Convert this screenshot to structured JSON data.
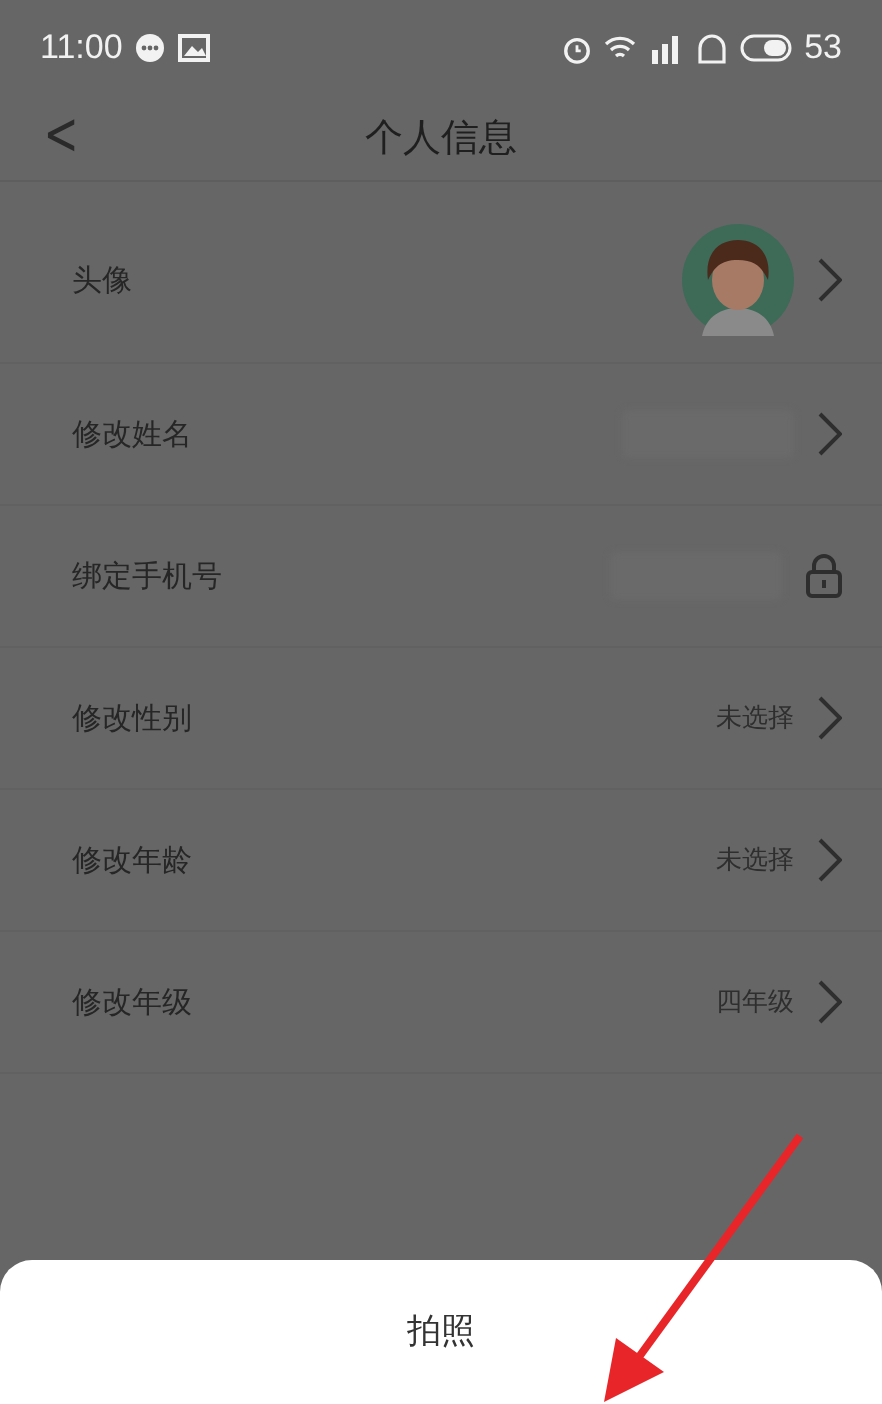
{
  "status_bar": {
    "time": "11:00",
    "battery": "53"
  },
  "header": {
    "back": "<",
    "title": "个人信息"
  },
  "rows": [
    {
      "label": "头像",
      "locked": false
    },
    {
      "label": "修改姓名",
      "kind": "redacted",
      "locked": false
    },
    {
      "label": "绑定手机号",
      "kind": "redacted",
      "locked": true
    },
    {
      "label": "修改性别",
      "kind": "text",
      "value": "未选择",
      "locked": false
    },
    {
      "label": "修改年龄",
      "kind": "text",
      "value": "未选择",
      "locked": false
    },
    {
      "label": "修改年级",
      "kind": "text",
      "value": "四年级",
      "locked": false
    }
  ],
  "sheet": {
    "options": [
      "拍照"
    ]
  },
  "annotation": {
    "kind": "arrow"
  }
}
